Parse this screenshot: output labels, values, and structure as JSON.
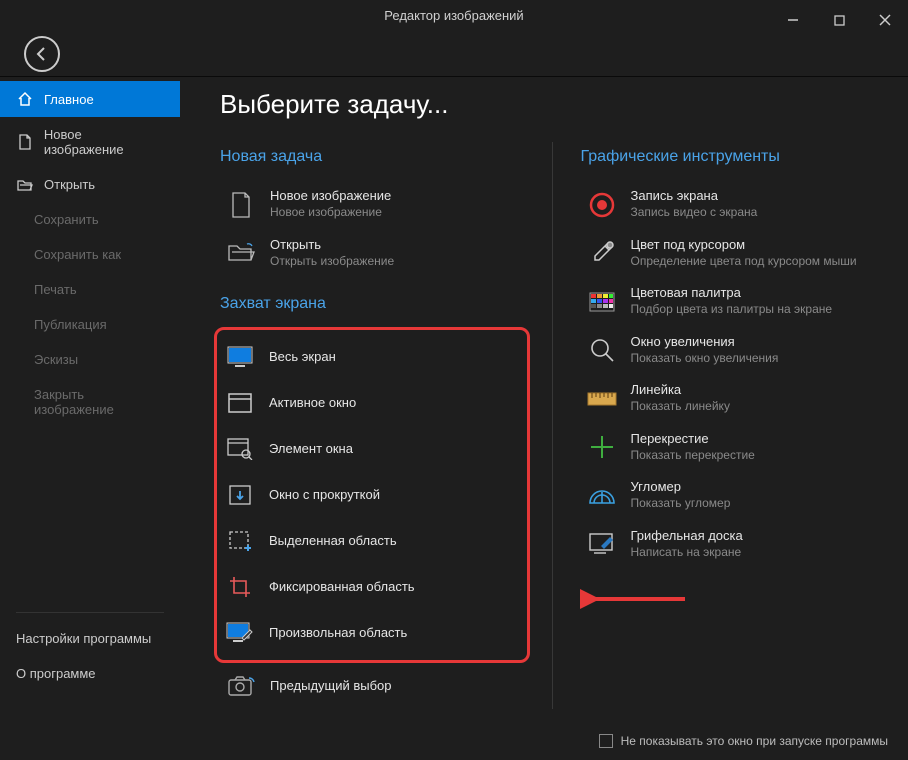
{
  "title": "Редактор изображений",
  "main_title": "Выберите задачу...",
  "sidebar": {
    "main": "Главное",
    "new_image": "Новое изображение",
    "open": "Открыть",
    "save": "Сохранить",
    "save_as": "Сохранить как",
    "print": "Печать",
    "publish": "Публикация",
    "thumbnails": "Эскизы",
    "close_image": "Закрыть изображение",
    "settings": "Настройки программы",
    "about": "О программе"
  },
  "sections": {
    "new_task": "Новая задача",
    "screen_capture": "Захват экрана",
    "graphic_tools": "Графические инструменты"
  },
  "tasks_new": [
    {
      "title": "Новое изображение",
      "sub": "Новое изображение"
    },
    {
      "title": "Открыть",
      "sub": "Открыть изображение"
    }
  ],
  "tasks_capture": [
    "Весь экран",
    "Активное окно",
    "Элемент окна",
    "Окно с прокруткой",
    "Выделенная область",
    "Фиксированная область",
    "Произвольная область"
  ],
  "task_prev": "Предыдущий выбор",
  "tools": [
    {
      "title": "Запись экрана",
      "sub": "Запись видео с экрана"
    },
    {
      "title": "Цвет под курсором",
      "sub": "Определение цвета под курсором мыши"
    },
    {
      "title": "Цветовая палитра",
      "sub": "Подбор цвета из палитры на экране"
    },
    {
      "title": "Окно увеличения",
      "sub": "Показать окно увеличения"
    },
    {
      "title": "Линейка",
      "sub": "Показать линейку"
    },
    {
      "title": "Перекрестие",
      "sub": "Показать перекрестие"
    },
    {
      "title": "Угломер",
      "sub": "Показать угломер"
    },
    {
      "title": "Грифельная доска",
      "sub": "Написать на экране"
    }
  ],
  "footer": "Не показывать это окно при запуске программы"
}
